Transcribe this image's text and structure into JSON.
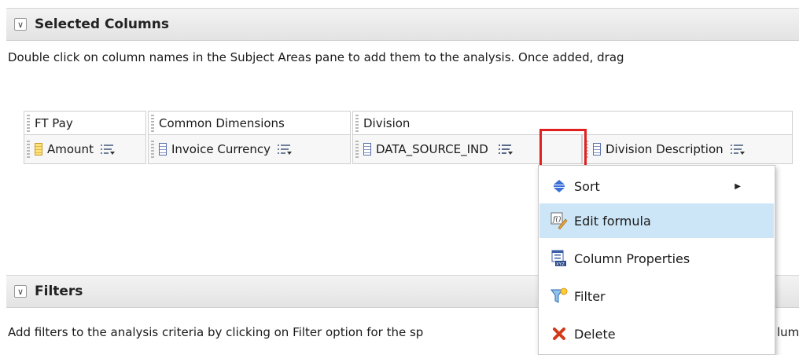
{
  "selected_columns": {
    "title": "Selected Columns",
    "instruction": "Double click on column names in the Subject Areas pane to add them to the analysis. Once added, drag",
    "groups": [
      {
        "label": "FT Pay"
      },
      {
        "label": "Common Dimensions"
      },
      {
        "label": "Division"
      }
    ],
    "columns": [
      {
        "label": "Amount",
        "type": "measure"
      },
      {
        "label": "Invoice Currency",
        "type": "attribute"
      },
      {
        "label": "DATA_SOURCE_IND",
        "type": "attribute"
      },
      {
        "label": "Division Description",
        "type": "attribute"
      }
    ]
  },
  "filters": {
    "title": "Filters",
    "instruction": "Add filters to the analysis criteria by clicking on Filter option for the sp",
    "instruction_tail": "lum"
  },
  "context_menu": {
    "items": [
      {
        "label": "Sort",
        "icon": "sort-icon",
        "has_submenu": true
      },
      {
        "label": "Edit formula",
        "icon": "edit-formula-icon",
        "highlighted": true
      },
      {
        "label": "Column Properties",
        "icon": "column-properties-icon"
      },
      {
        "label": "Filter",
        "icon": "filter-icon"
      },
      {
        "label": "Delete",
        "icon": "delete-icon"
      }
    ]
  },
  "colors": {
    "highlight_border": "#e02020",
    "menu_hover": "#cde6f7",
    "header_bg": "#e8e8e8"
  }
}
